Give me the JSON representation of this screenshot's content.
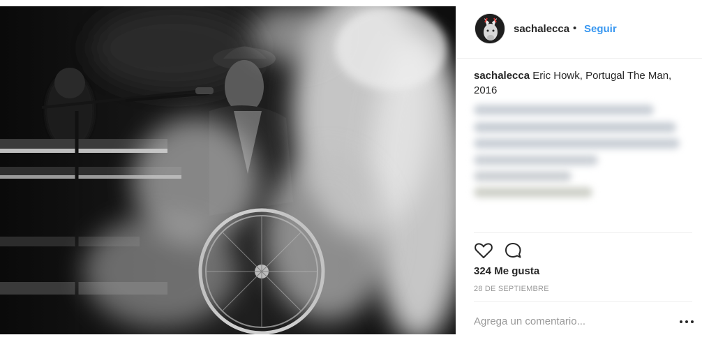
{
  "post": {
    "username": "sachalecca",
    "separator": "•",
    "follow_label": "Seguir",
    "caption_user": "sachalecca",
    "caption_text": "Eric Howk, Portugal The Man, 2016",
    "likes": "324 Me gusta",
    "date": "28 DE SEPTIEMBRE",
    "comment_placeholder": "Agrega un comentario..."
  },
  "icons": {
    "like": "heart-outline-icon",
    "comment": "speech-bubble-icon",
    "more": "more-options-icon"
  },
  "colors": {
    "accent": "#3897f0",
    "text": "#262626",
    "muted": "#999999",
    "divider": "#efefef"
  }
}
